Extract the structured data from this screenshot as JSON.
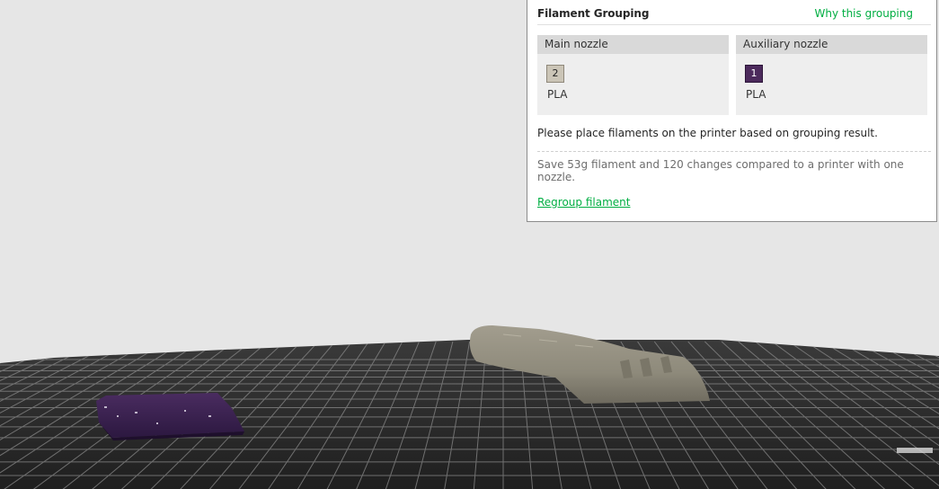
{
  "panel": {
    "title": "Filament Grouping",
    "why_link": "Why this grouping",
    "main_nozzle": {
      "label": "Main nozzle",
      "filament": {
        "slot": "2",
        "material": "PLA",
        "color": "#cbc5b7"
      }
    },
    "aux_nozzle": {
      "label": "Auxiliary nozzle",
      "filament": {
        "slot": "1",
        "material": "PLA",
        "color": "#4c2a5c"
      }
    },
    "instruction": "Please place filaments on the printer based on grouping result.",
    "savings_note": "Save 53g filament and 120 changes compared to a printer with one nozzle.",
    "regroup_link": "Regroup filament"
  },
  "scene": {
    "background_color": "#e6e6e6",
    "plate_color": "#2a2a2a",
    "grid_color": "#8a8a8a",
    "objects": [
      {
        "name": "beige-part",
        "color": "#8e8a7b"
      },
      {
        "name": "purple-part",
        "color": "#3d2350"
      }
    ]
  }
}
